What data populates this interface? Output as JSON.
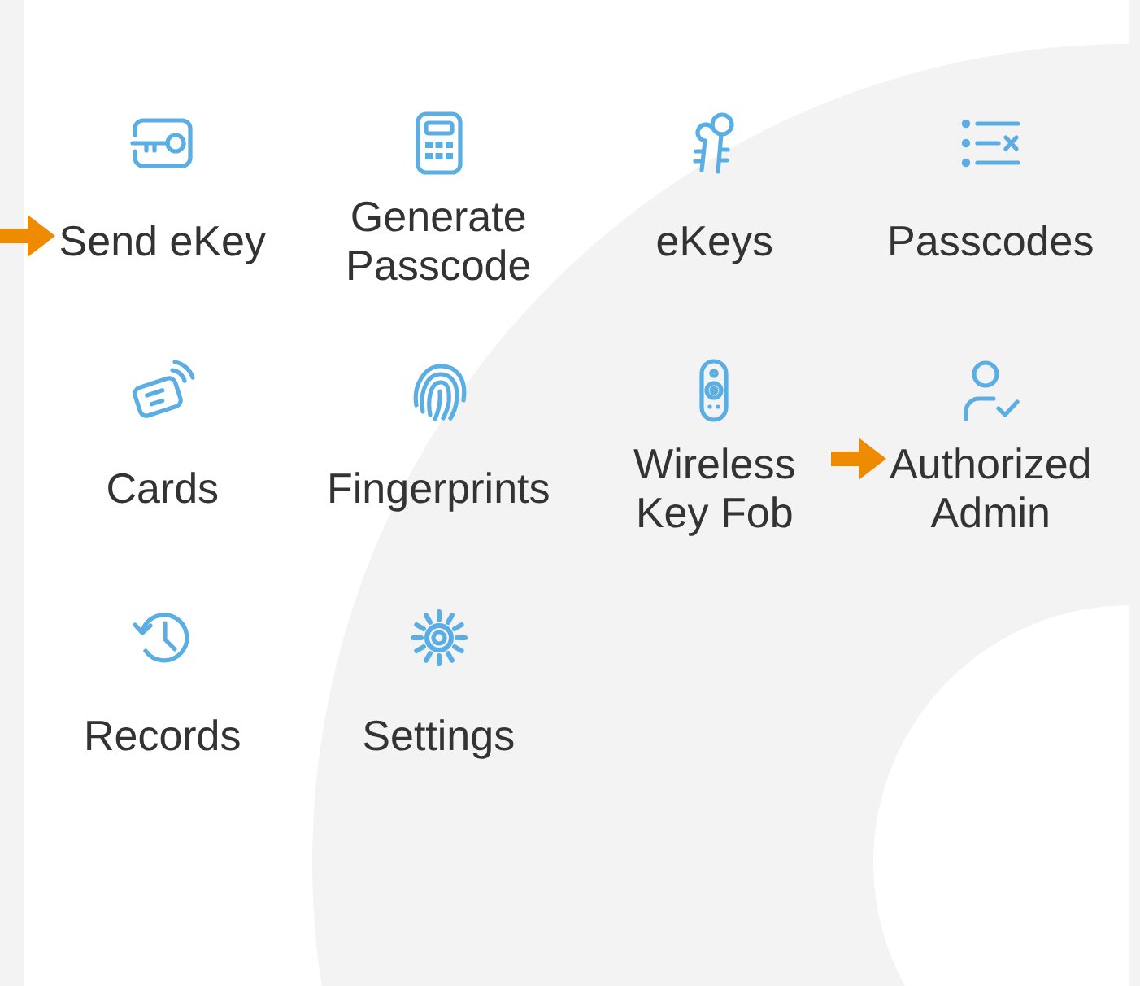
{
  "items": [
    {
      "label": "Send eKey",
      "arrow": true
    },
    {
      "label": "Generate Passcode",
      "arrow": false
    },
    {
      "label": "eKeys",
      "arrow": false
    },
    {
      "label": "Passcodes",
      "arrow": false
    },
    {
      "label": "Cards",
      "arrow": false
    },
    {
      "label": "Fingerprints",
      "arrow": false
    },
    {
      "label": "Wireless Key Fob",
      "arrow": false
    },
    {
      "label": "Authorized Admin",
      "arrow": true
    },
    {
      "label": "Records",
      "arrow": false
    },
    {
      "label": "Settings",
      "arrow": false
    }
  ]
}
